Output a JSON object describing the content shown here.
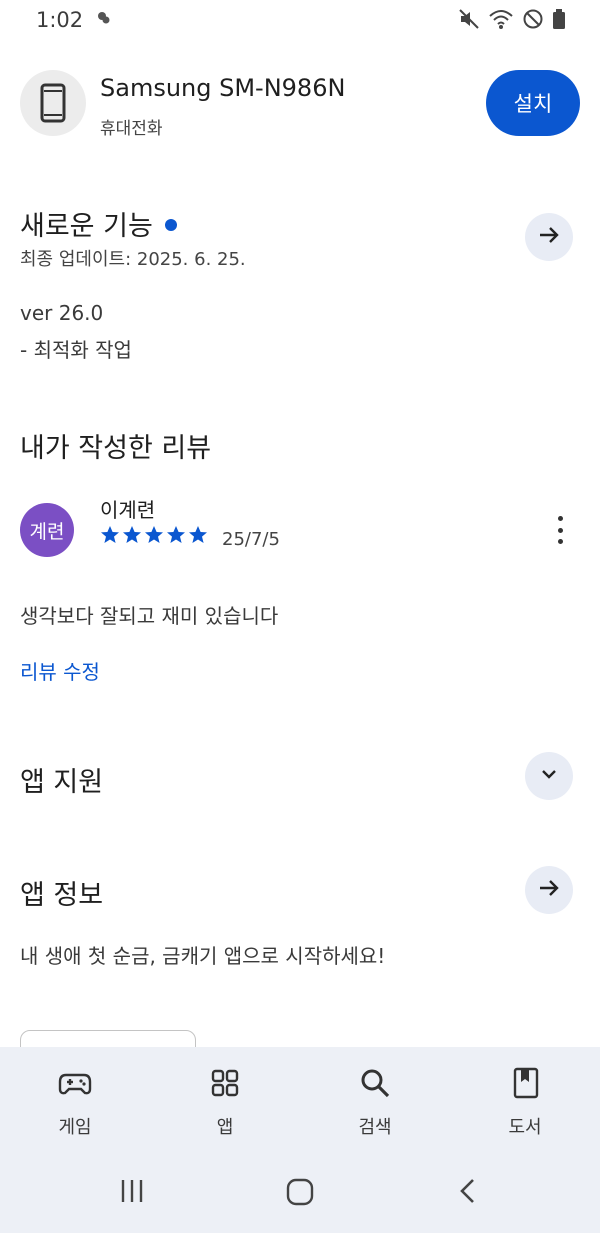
{
  "status_bar": {
    "time": "1:02",
    "icons": [
      "chat-icon",
      "mute-icon",
      "wifi-icon",
      "do-not-disturb-icon",
      "battery-icon"
    ]
  },
  "device": {
    "name": "Samsung SM-N986N",
    "type": "휴대전화",
    "install_label": "설치",
    "icon": "phone-icon"
  },
  "whats_new": {
    "title": "새로운 기능",
    "updated": "최종 업데이트: 2025. 6. 25.",
    "version": "ver 26.0",
    "notes": "- 최적화 작업"
  },
  "my_review": {
    "title": "내가 작성한 리뷰",
    "avatar_text": "계련",
    "reviewer": "이계련",
    "rating": 5,
    "date": "25/7/5",
    "text": "생각보다 잘되고 재미 있습니다",
    "edit_label": "리뷰 수정"
  },
  "app_support": {
    "title": "앱 지원"
  },
  "app_info": {
    "title": "앱 정보",
    "description": "내 생애 첫 순금, 금캐기 앱으로 시작하세요!"
  },
  "bottom_nav": {
    "items": [
      {
        "label": "게임",
        "icon": "gamepad-icon"
      },
      {
        "label": "앱",
        "icon": "apps-grid-icon"
      },
      {
        "label": "검색",
        "icon": "search-icon"
      },
      {
        "label": "도서",
        "icon": "book-icon"
      }
    ]
  },
  "colors": {
    "accent": "#0b57d0",
    "avatar": "#7b4fc4",
    "nav_bg": "#edf0f6",
    "circle_btn_bg": "#e8ecf5"
  }
}
